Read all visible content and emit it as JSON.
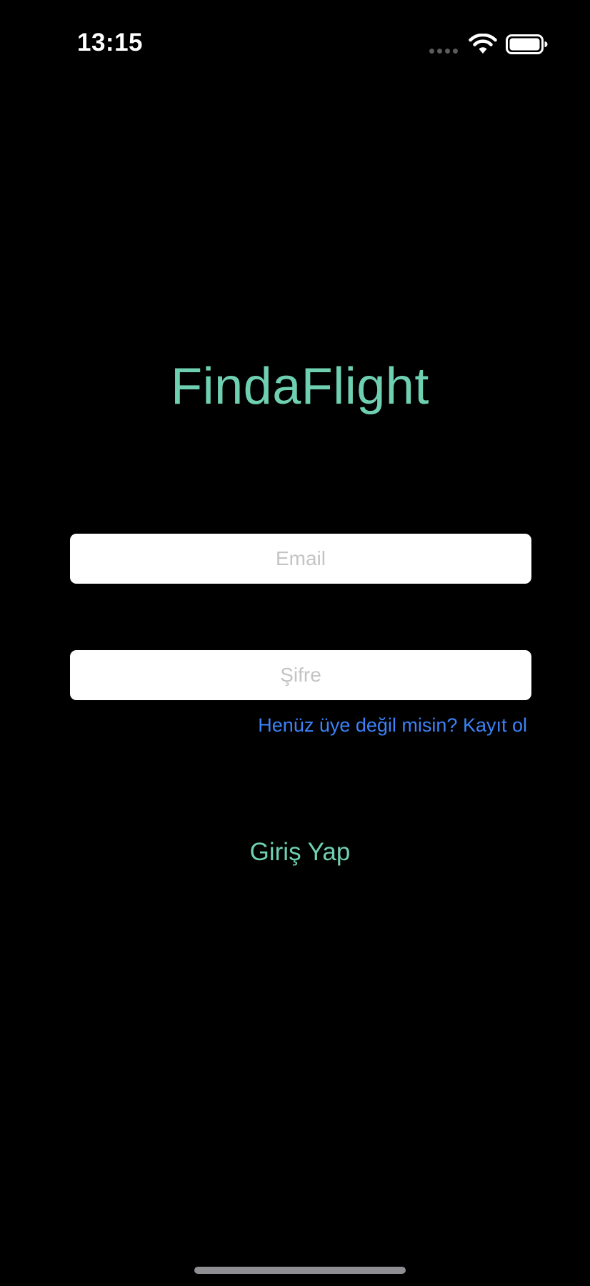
{
  "status_bar": {
    "time": "13:15",
    "signal_icon": "cellular-dots-icon",
    "wifi_icon": "wifi-icon",
    "battery_icon": "battery-icon"
  },
  "app": {
    "title": "FindaFlight",
    "accent_color": "#6fcfb1",
    "link_color": "#3b82f6"
  },
  "login_form": {
    "email_placeholder": "Email",
    "email_value": "",
    "password_placeholder": "Şifre",
    "password_value": "",
    "signup_link": "Henüz üye değil misin? Kayıt ol",
    "login_button": "Giriş Yap"
  }
}
